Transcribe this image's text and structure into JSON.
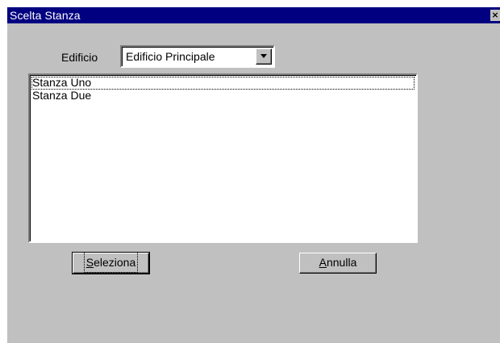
{
  "window": {
    "title": "Scelta Stanza",
    "close_glyph": "×",
    "colors": {
      "titlebar": "#000080",
      "face": "#c0c0c0"
    }
  },
  "form": {
    "edificio_label": "Edificio",
    "edificio_selected": "Edificio Principale",
    "dropdown_arrow_icon": "chevron-down-icon"
  },
  "rooms": [
    {
      "label": "Stanza Uno"
    },
    {
      "label": "Stanza Due"
    }
  ],
  "buttons": {
    "select": {
      "mnemonic": "S",
      "rest": "eleziona"
    },
    "cancel": {
      "mnemonic": "A",
      "rest": "nnulla"
    }
  }
}
